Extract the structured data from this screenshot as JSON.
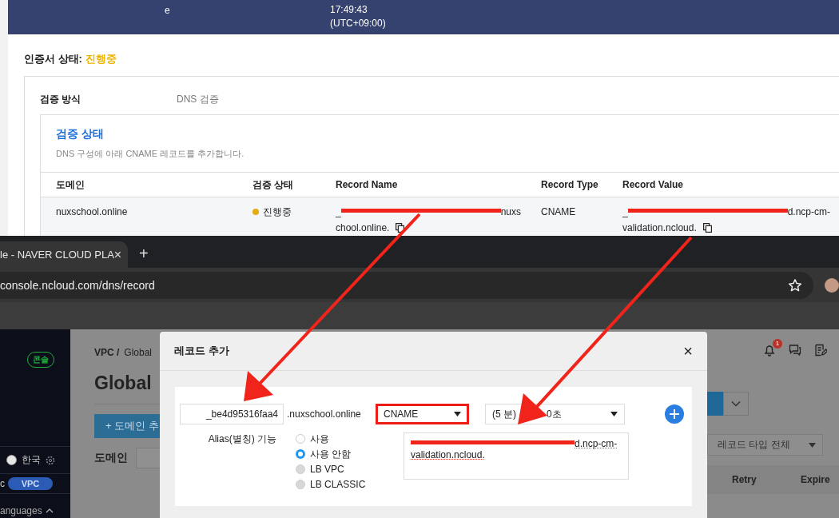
{
  "header_banner": {
    "column_1": "e",
    "time": "17:49:43",
    "timezone": "(UTC+09:00)"
  },
  "certificate_status": {
    "label": "인증서 상태:",
    "value": "진행중"
  },
  "validation": {
    "method_label": "검증 방식",
    "method_value": "DNS 검증",
    "status_title": "검증 상태",
    "description": "DNS 구성에 아래 CNAME 레코드를 추가합니다.",
    "columns": [
      "도메인",
      "검증 상태",
      "Record Name",
      "Record Type",
      "Record Value"
    ],
    "rows": [
      {
        "domain": "nuxschool.online",
        "status": "진행중",
        "color": "#e6ad12",
        "record_name_start": "_",
        "record_name_end": "nuxs",
        "record_name_line2": "chool.online.",
        "record_type": "CNAME",
        "record_value_start": "_",
        "record_value_end": "d.ncp-cm-",
        "record_value_line2": "validation.ncloud."
      }
    ]
  },
  "browser": {
    "tab_title": "le - NAVER CLOUD PLA",
    "tab_close": "×",
    "new_tab": "+",
    "url": "console.ncloud.com/dns/record"
  },
  "sidebar": {
    "console_badge": "콘솔",
    "language": "한국",
    "mode_left": "c",
    "mode_selected": "VPC",
    "languages": "anguages"
  },
  "page": {
    "breadcrumb": [
      "VPC /",
      "Global"
    ],
    "title": "Global",
    "add_domain_button": "+ 도메인 추",
    "domain_label": "도메인",
    "notification_count": "1",
    "record_type_filter": "레코드 타입 전체",
    "columns": [
      "Retry",
      "Expire"
    ]
  },
  "modal": {
    "title": "레코드 추가",
    "close": "×",
    "record_name": "_be4d95316faa4",
    "domain_suffix": ".nuxschool.online",
    "record_type": "CNAME",
    "ttl_start": "(5 분)",
    "ttl_end": "0초",
    "alias_label": "Alias(별칭) 기능",
    "alias_options": [
      {
        "label": "사용",
        "selected": false,
        "disabled": false
      },
      {
        "label": "사용 안함",
        "selected": true,
        "disabled": false
      },
      {
        "label": "LB VPC",
        "selected": false,
        "disabled": true
      },
      {
        "label": "LB CLASSIC",
        "selected": false,
        "disabled": true
      }
    ],
    "record_value_end": "d.ncp-cm-",
    "record_value_line2": "validation.ncloud."
  }
}
